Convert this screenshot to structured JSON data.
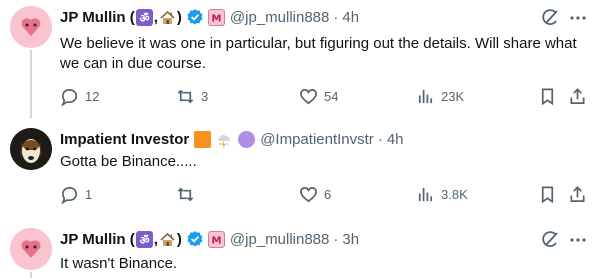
{
  "tweets": [
    {
      "author_name": "JP Mullin (",
      "author_name_mid": ",",
      "author_name_end": ")",
      "handle": "@jp_mullin888",
      "time": "4h",
      "text": "We believe it was one in particular, but figuring out the details. Will share what we can in due course.",
      "replies": "12",
      "reposts": "3",
      "likes": "54",
      "views": "23K"
    },
    {
      "author_name": "Impatient Investor",
      "handle": "@ImpatientInvstr",
      "time": "4h",
      "text": "Gotta be Binance.....",
      "replies": "1",
      "reposts": "",
      "likes": "6",
      "views": "3.8K"
    },
    {
      "author_name": "JP Mullin (",
      "author_name_mid": ",",
      "author_name_end": ")",
      "handle": "@jp_mullin888",
      "time": "3h",
      "text": "It wasn't Binance."
    }
  ],
  "separator": "·",
  "colors": {
    "text": "#0f1419",
    "muted": "#536471",
    "verified": "#1d9bf0",
    "thread_line": "#cfd9de"
  },
  "icons": {
    "om_emoji": "om-icon",
    "house_emoji": "house-icon",
    "m_emoji": "m-icon",
    "verified": "verified-badge-icon",
    "grok": "grok-icon",
    "more": "more-icon",
    "reply": "reply-icon",
    "repost": "repost-icon",
    "like": "like-icon",
    "views": "views-icon",
    "bookmark": "bookmark-icon",
    "share": "share-icon"
  }
}
